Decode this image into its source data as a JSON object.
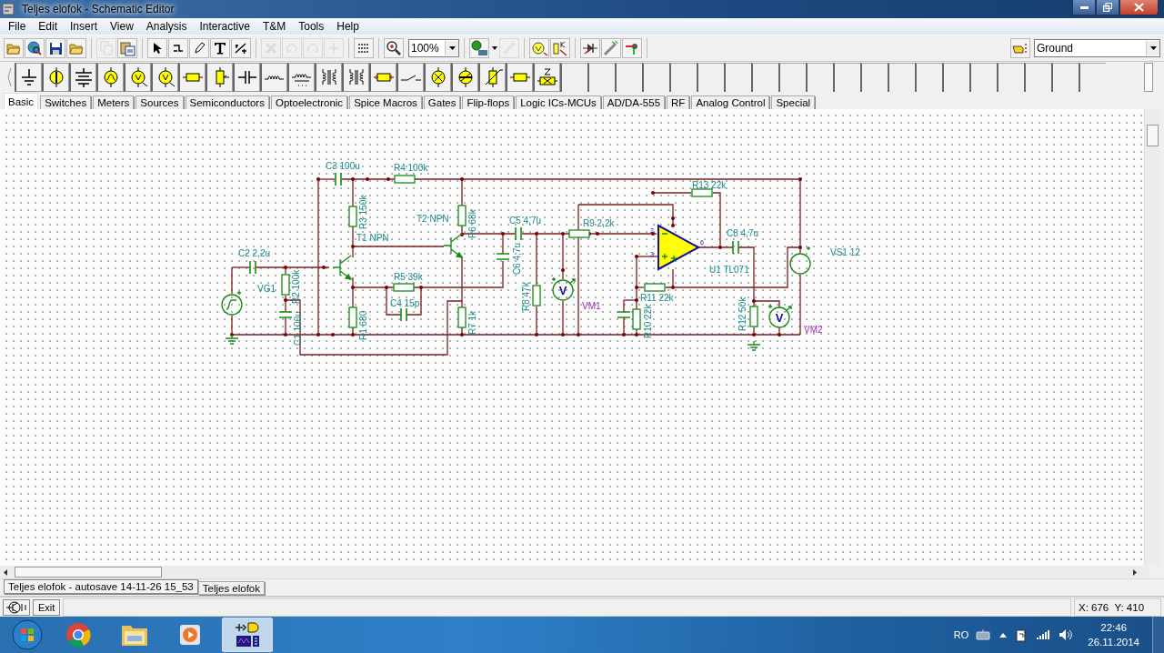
{
  "window": {
    "title": "Teljes elofok - Schematic Editor"
  },
  "menu": [
    "File",
    "Edit",
    "Insert",
    "View",
    "Analysis",
    "Interactive",
    "T&M",
    "Tools",
    "Help"
  ],
  "toolbar": {
    "buttons": [
      {
        "kind": "open",
        "disabled": false
      },
      {
        "kind": "web",
        "disabled": false
      },
      {
        "kind": "save",
        "disabled": false
      },
      {
        "kind": "open",
        "disabled": false
      },
      {
        "kind": "sep"
      },
      {
        "kind": "copy",
        "disabled": true
      },
      {
        "kind": "paste",
        "disabled": false
      },
      {
        "kind": "sep"
      },
      {
        "kind": "select",
        "disabled": false
      },
      {
        "kind": "wire",
        "disabled": false
      },
      {
        "kind": "pencil",
        "disabled": false
      },
      {
        "kind": "text",
        "disabled": false
      },
      {
        "kind": "split",
        "disabled": false
      },
      {
        "kind": "sep"
      },
      {
        "kind": "delete",
        "disabled": true
      },
      {
        "kind": "undo",
        "disabled": true
      },
      {
        "kind": "redo",
        "disabled": true
      },
      {
        "kind": "junction",
        "disabled": true
      },
      {
        "kind": "sep"
      },
      {
        "kind": "grid",
        "disabled": false
      },
      {
        "kind": "sep"
      },
      {
        "kind": "zoom",
        "disabled": false
      }
    ],
    "zoom": "100%",
    "buttons2": [
      {
        "kind": "dc",
        "disabled": false
      },
      {
        "kind": "probe",
        "disabled": true
      },
      {
        "kind": "sep"
      },
      {
        "kind": "meter",
        "disabled": false
      },
      {
        "kind": "param",
        "disabled": false
      },
      {
        "kind": "sep"
      },
      {
        "kind": "diode",
        "disabled": false
      },
      {
        "kind": "led",
        "disabled": false
      },
      {
        "kind": "pin",
        "disabled": false
      }
    ],
    "layer": "Ground"
  },
  "component_tabs": [
    {
      "label": "Basic",
      "selected": true
    },
    {
      "label": "Switches",
      "selected": false
    },
    {
      "label": "Meters",
      "selected": false
    },
    {
      "label": "Sources",
      "selected": false
    },
    {
      "label": "Semiconductors",
      "selected": false
    },
    {
      "label": "Optoelectronic",
      "selected": false
    },
    {
      "label": "Spice Macros",
      "selected": false
    },
    {
      "label": "Gates",
      "selected": false
    },
    {
      "label": "Flip-flops",
      "selected": false
    },
    {
      "label": "Logic ICs-MCUs",
      "selected": false
    },
    {
      "label": "AD/DA-555",
      "selected": false
    },
    {
      "label": "RF",
      "selected": false
    },
    {
      "label": "Analog Control",
      "selected": false
    },
    {
      "label": "Special",
      "selected": false
    }
  ],
  "schematic": {
    "components": [
      {
        "kind": "capacitor",
        "label": "C2 2,2u"
      },
      {
        "kind": "sine_source",
        "label": "VG1"
      },
      {
        "kind": "resistor",
        "label": "R2 100k"
      },
      {
        "kind": "capacitor",
        "label": "C1 100u"
      },
      {
        "kind": "capacitor",
        "label": "C3 100u"
      },
      {
        "kind": "resistor",
        "label": "R4 100k"
      },
      {
        "kind": "resistor",
        "label": "R3 150k"
      },
      {
        "kind": "npn",
        "label": "T1 NPN"
      },
      {
        "kind": "resistor",
        "label": "R1 680"
      },
      {
        "kind": "resistor",
        "label": "R5 39k"
      },
      {
        "kind": "capacitor",
        "label": "C4 15p"
      },
      {
        "kind": "npn",
        "label": "T2 NPN"
      },
      {
        "kind": "resistor",
        "label": "R6 68k"
      },
      {
        "kind": "resistor",
        "label": "R7 1k"
      },
      {
        "kind": "capacitor",
        "label": "C5 4,7u"
      },
      {
        "kind": "capacitor",
        "label": "C6 4,7u"
      },
      {
        "kind": "resistor",
        "label": "R9 2,2k"
      },
      {
        "kind": "resistor",
        "label": "R8 47k"
      },
      {
        "kind": "voltmeter",
        "label": "VM1",
        "symbol": "V"
      },
      {
        "kind": "resistor",
        "label": "R13 22k"
      },
      {
        "kind": "opamp",
        "label": "U1 TL071",
        "pins": [
          "2",
          "3",
          "6"
        ]
      },
      {
        "kind": "resistor",
        "label": "R11 22k"
      },
      {
        "kind": "resistor",
        "label": "R10 22k"
      },
      {
        "kind": "capacitor"
      },
      {
        "kind": "capacitor",
        "label": "C8 4,7u"
      },
      {
        "kind": "resistor",
        "label": "R12 50k"
      },
      {
        "kind": "voltmeter",
        "label": "VM2",
        "symbol": "V"
      },
      {
        "kind": "dc_source",
        "label": "VS1 12"
      },
      {
        "kind": "ground"
      },
      {
        "kind": "ground"
      }
    ]
  },
  "document_tabs": [
    {
      "label": "Teljes elofok - autosave 14-11-26 15_53",
      "selected": true
    },
    {
      "label": "Teljes elofok",
      "selected": false
    }
  ],
  "status_bar": {
    "exit": "Exit",
    "coordinates": "X: 676  Y: 410"
  },
  "taskbar": {
    "language": "RO",
    "time": "22:46",
    "date": "26.11.2014"
  }
}
